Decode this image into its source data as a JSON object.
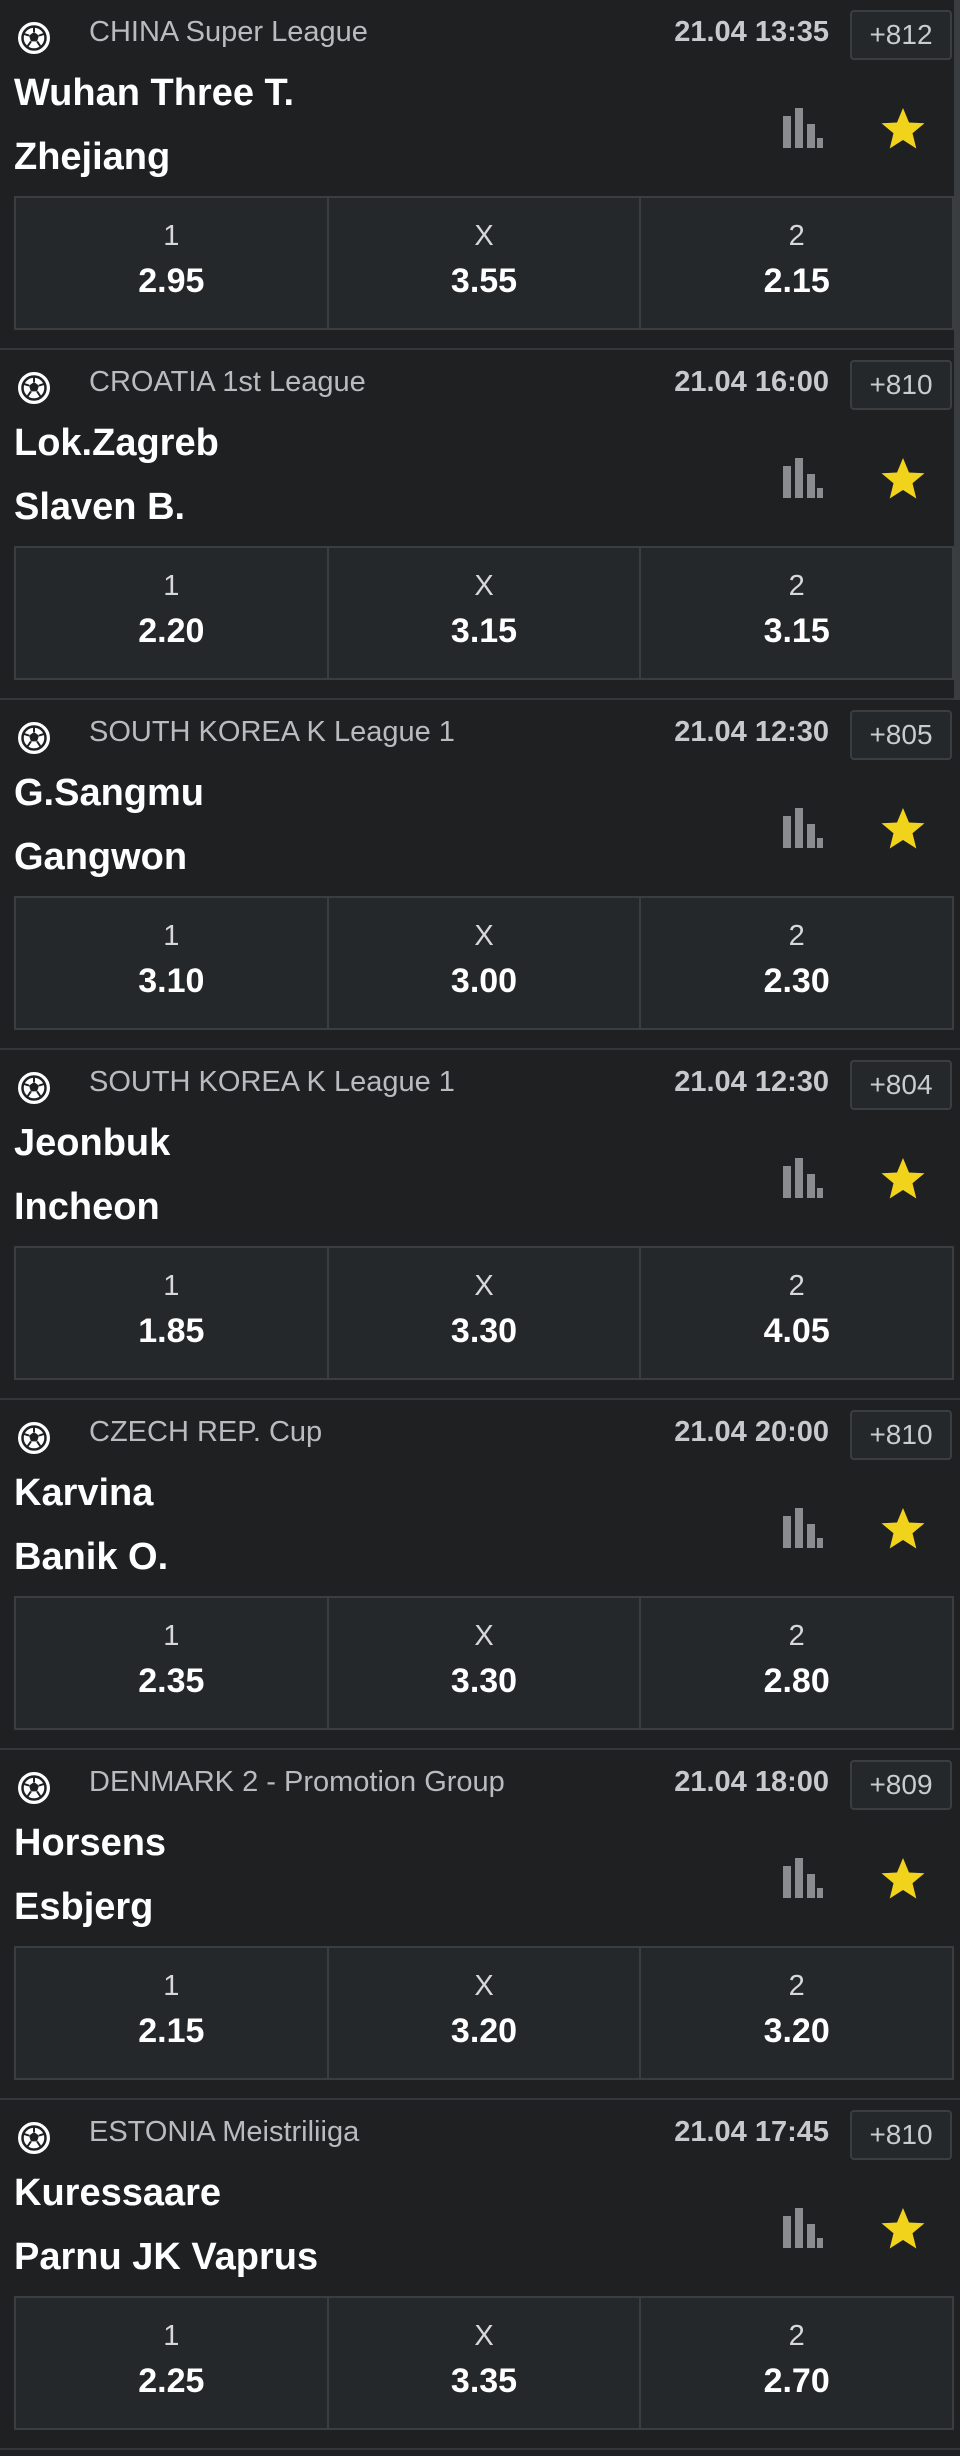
{
  "colors": {
    "background": "#1e2022",
    "card": "#25282a",
    "border": "#3b3e41",
    "star": "#f2d31b",
    "stats": "#8a8d90"
  },
  "icons": {
    "sport": "soccer-ball-icon",
    "stats": "bar-chart-icon",
    "favorite": "star-icon"
  },
  "matches": [
    {
      "league": "CHINA Super League",
      "datetime": "21.04 13:35",
      "more": "+812",
      "home": "Wuhan Three T.",
      "away": "Zhejiang",
      "odds": [
        {
          "label": "1",
          "value": "2.95"
        },
        {
          "label": "X",
          "value": "3.55"
        },
        {
          "label": "2",
          "value": "2.15"
        }
      ]
    },
    {
      "league": "CROATIA 1st League",
      "datetime": "21.04 16:00",
      "more": "+810",
      "home": "Lok.Zagreb",
      "away": "Slaven B.",
      "odds": [
        {
          "label": "1",
          "value": "2.20"
        },
        {
          "label": "X",
          "value": "3.15"
        },
        {
          "label": "2",
          "value": "3.15"
        }
      ]
    },
    {
      "league": "SOUTH KOREA K League 1",
      "datetime": "21.04 12:30",
      "more": "+805",
      "home": "G.Sangmu",
      "away": "Gangwon",
      "odds": [
        {
          "label": "1",
          "value": "3.10"
        },
        {
          "label": "X",
          "value": "3.00"
        },
        {
          "label": "2",
          "value": "2.30"
        }
      ]
    },
    {
      "league": "SOUTH KOREA K League 1",
      "datetime": "21.04 12:30",
      "more": "+804",
      "home": "Jeonbuk",
      "away": "Incheon",
      "odds": [
        {
          "label": "1",
          "value": "1.85"
        },
        {
          "label": "X",
          "value": "3.30"
        },
        {
          "label": "2",
          "value": "4.05"
        }
      ]
    },
    {
      "league": "CZECH REP. Cup",
      "datetime": "21.04 20:00",
      "more": "+810",
      "home": "Karvina",
      "away": "Banik O.",
      "odds": [
        {
          "label": "1",
          "value": "2.35"
        },
        {
          "label": "X",
          "value": "3.30"
        },
        {
          "label": "2",
          "value": "2.80"
        }
      ]
    },
    {
      "league": "DENMARK 2 - Promotion Group",
      "datetime": "21.04 18:00",
      "more": "+809",
      "home": "Horsens",
      "away": "Esbjerg",
      "odds": [
        {
          "label": "1",
          "value": "2.15"
        },
        {
          "label": "X",
          "value": "3.20"
        },
        {
          "label": "2",
          "value": "3.20"
        }
      ]
    },
    {
      "league": "ESTONIA Meistriliiga",
      "datetime": "21.04 17:45",
      "more": "+810",
      "home": "Kuressaare",
      "away": "Parnu JK Vaprus",
      "odds": [
        {
          "label": "1",
          "value": "2.25"
        },
        {
          "label": "X",
          "value": "3.35"
        },
        {
          "label": "2",
          "value": "2.70"
        }
      ]
    }
  ]
}
